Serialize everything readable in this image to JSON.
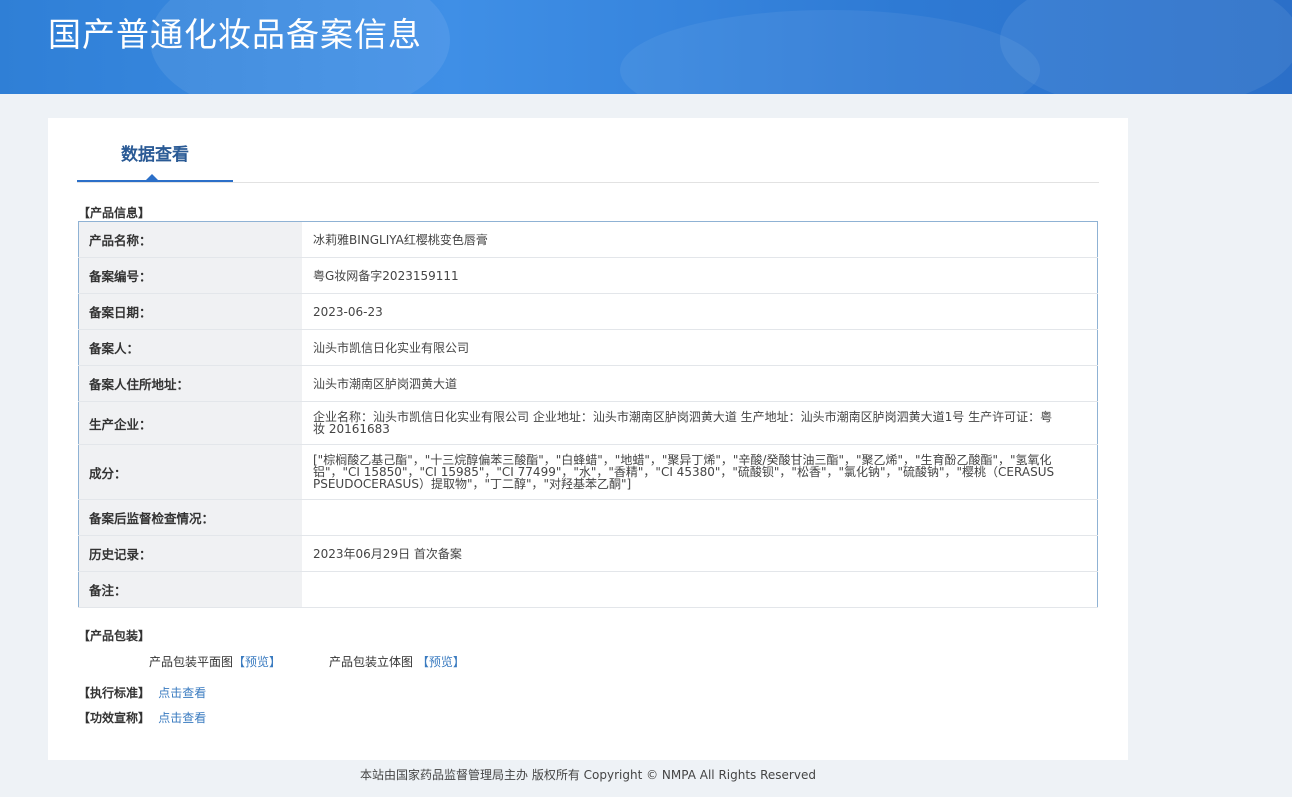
{
  "header": {
    "title": "国产普通化妆品备案信息"
  },
  "tab": {
    "label": "数据查看"
  },
  "sections": {
    "product_info": "【产品信息】",
    "packaging": "【产品包装】",
    "standard": "【执行标准】",
    "efficacy": "【功效宣称】"
  },
  "product_info": [
    {
      "key": "产品名称：",
      "value": "冰莉雅BINGLIYA红樱桃变色唇膏"
    },
    {
      "key": "备案编号：",
      "value": "粤G妆网备字2023159111"
    },
    {
      "key": "备案日期：",
      "value": "2023-06-23"
    },
    {
      "key": "备案人：",
      "value": "汕头市凯信日化实业有限公司"
    },
    {
      "key": "备案人住所地址：",
      "value": "汕头市潮南区胪岗泗黄大道"
    },
    {
      "key": "生产企业：",
      "value": "企业名称：汕头市凯信日化实业有限公司 企业地址：汕头市潮南区胪岗泗黄大道 生产地址：汕头市潮南区胪岗泗黄大道1号 生产许可证：粤妆 20161683"
    },
    {
      "key": "成分：",
      "value": "[\"棕榈酸乙基己酯\"，\"十三烷醇偏苯三酸酯\"，\"白蜂蜡\"，\"地蜡\"，\"聚异丁烯\"，\"辛酸/癸酸甘油三酯\"，\"聚乙烯\"，\"生育酚乙酸酯\"，\"氢氧化铝\"，\"CI 15850\"，\"CI 15985\"，\"CI 77499\"，\"水\"，\"香精\"，\"CI 45380\"，\"硫酸钡\"，\"松香\"，\"氯化钠\"，\"硫酸钠\"，\"樱桃（CERASUS PSEUDOCERASUS）提取物\"，\"丁二醇\"，\"对羟基苯乙酮\"]"
    },
    {
      "key": "备案后监督检查情况：",
      "value": ""
    },
    {
      "key": "历史记录：",
      "value": "2023年06月29日 首次备案"
    },
    {
      "key": "备注：",
      "value": ""
    }
  ],
  "packaging": {
    "flat_label": "产品包装平面图",
    "flat_link": "【预览】",
    "stereo_label": "产品包装立体图",
    "stereo_link": "【预览】"
  },
  "links": {
    "standard": "点击查看",
    "efficacy": "点击查看"
  },
  "footer": {
    "text": "本站由国家药品监督管理局主办 版权所有 Copyright © NMPA All Rights Reserved"
  }
}
